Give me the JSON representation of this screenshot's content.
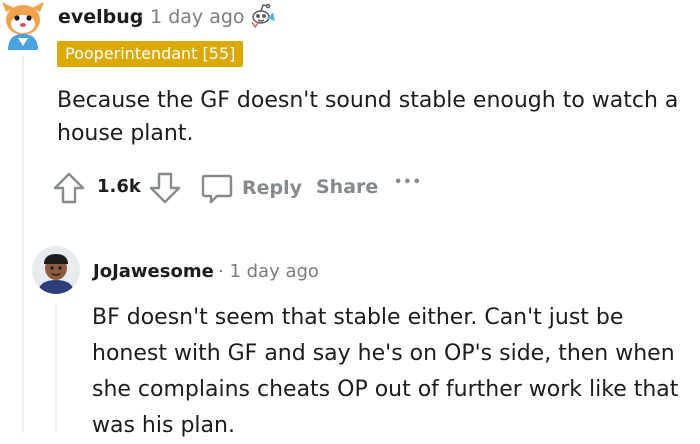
{
  "comment1": {
    "author": "evelbug",
    "time": "· 1 day ago",
    "flair": "Pooperintendant [55]",
    "body": "Because the GF doesn't sound stable enough to watch a house plant.",
    "votes": "1.6k",
    "actions": {
      "reply": "Reply",
      "share": "Share",
      "more": "•••"
    }
  },
  "comment2": {
    "author": "JoJawesome",
    "time": "· 1 day ago",
    "body": "BF doesn't seem that stable either. Can't just be honest with GF and say he's on OP's side, then when she complains cheats OP out of further work like that was his plan."
  },
  "colors": {
    "flair": "#dbaa00",
    "muted": "#7c7c7c",
    "action": "#878a8c",
    "thread_line": "#edeff1"
  }
}
